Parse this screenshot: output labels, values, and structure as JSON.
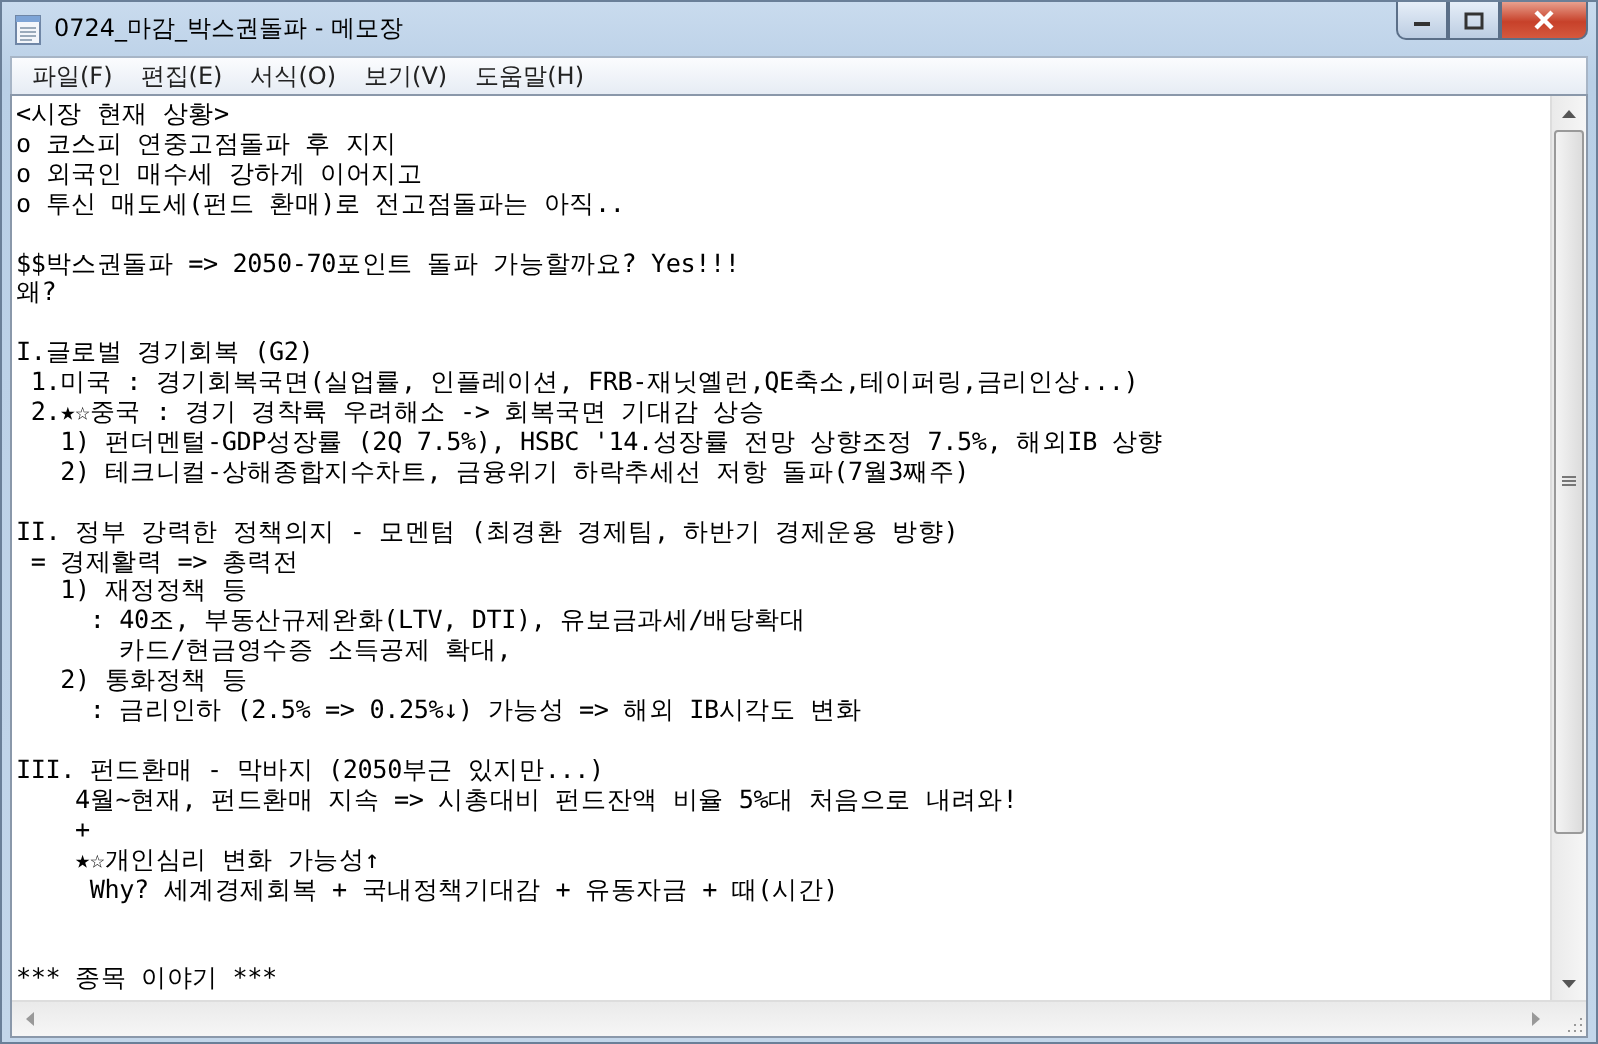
{
  "window": {
    "title": "0724_마감_박스권돌파 - 메모장"
  },
  "menu": [
    {
      "label": "파일(F)"
    },
    {
      "label": "편집(E)"
    },
    {
      "label": "서식(O)"
    },
    {
      "label": "보기(V)"
    },
    {
      "label": "도움말(H)"
    }
  ],
  "document": {
    "paragraphs": [
      {
        "lines": [
          "<시장 현재 상황>",
          "o 코스피 연중고점돌파 후 지지",
          "o 외국인 매수세 강하게 이어지고",
          "o 투신 매도세(펀드 환매)로 전고점돌파는 아직.."
        ],
        "extra_gap": false
      },
      {
        "lines": [
          "$$박스권돌파 => 2050-70포인트 돌파 가능할까요? Yes!!!",
          "왜?"
        ],
        "extra_gap": false
      },
      {
        "lines": [
          "I.글로벌 경기회복 (G2)",
          " 1.미국 : 경기회복국면(실업률, 인플레이션, FRB-재닛옐런,QE축소,테이퍼링,금리인상...)",
          " 2.★☆중국 : 경기 경착륙 우려해소 -> 회복국면 기대감 상승",
          "   1) 펀더멘털-GDP성장률 (2Q 7.5%), HSBC '14.성장률 전망 상향조정 7.5%, 해외IB 상향",
          "   2) 테크니컬-상해종합지수차트, 금융위기 하락추세선 저항 돌파(7월3째주)"
        ],
        "extra_gap": false
      },
      {
        "lines": [
          "II. 정부 강력한 정책의지 - 모멘텀 (최경환 경제팀, 하반기 경제운용 방향)",
          " = 경제활력 => 총력전",
          "   1) 재정정책 등",
          "     : 40조, 부동산규제완화(LTV, DTI), 유보금과세/배당확대",
          "       카드/현금영수증 소득공제 확대,",
          "   2) 통화정책 등",
          "     : 금리인하 (2.5% => 0.25%↓) 가능성 => 해외 IB시각도 변화"
        ],
        "extra_gap": false
      },
      {
        "lines": [
          "III. 펀드환매 - 막바지 (2050부근 있지만...)",
          "    4월~현재, 펀드환매 지속 => 시총대비 펀드잔액 비율 5%대 처음으로 내려와!",
          "    +",
          "    ★☆개인심리 변화 가능성↑",
          "     Why? 세계경제회복 + 국내정책기대감 + 유동자금 + 때(시간)"
        ],
        "extra_gap": true
      },
      {
        "lines": [
          "*** 종목 이야기 ***"
        ],
        "extra_gap": false
      }
    ]
  }
}
